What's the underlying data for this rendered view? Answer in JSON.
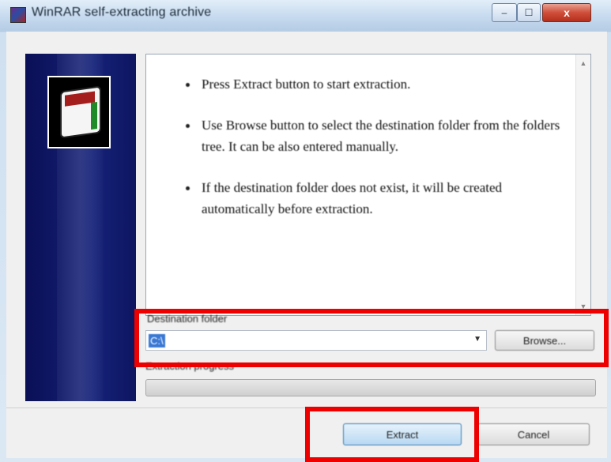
{
  "window": {
    "title": "WinRAR self-extracting archive",
    "controls": {
      "minimize": "‒",
      "maximize": "☐",
      "close": "x"
    }
  },
  "info": {
    "items": [
      "Press Extract button to start extraction.",
      "Use Browse button to select the destination folder from the folders tree. It can be also entered manually.",
      "If the destination folder does not exist, it will be created automatically before extraction."
    ]
  },
  "destination": {
    "label": "Destination folder",
    "value": "C:\\",
    "browse_label": "Browse..."
  },
  "progress": {
    "label": "Extraction progress",
    "fraction": 0
  },
  "buttons": {
    "extract_label": "Extract",
    "cancel_label": "Cancel"
  },
  "colors": {
    "highlight": "#ee0000",
    "side_panel": "#0d1560"
  }
}
